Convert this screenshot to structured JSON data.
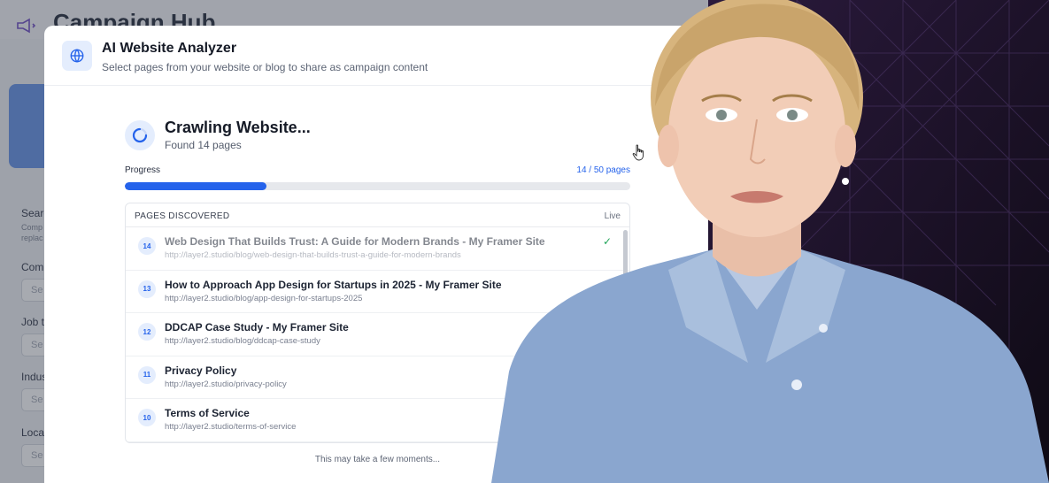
{
  "background_app": {
    "title": "Campaign Hub",
    "sidebar": {
      "search_label": "Searc",
      "search_desc_1": "Comp",
      "search_desc_2": "replac",
      "company_label": "Comp",
      "company_placeholder": "Se",
      "job_title_label": "Job t",
      "job_title_placeholder": "Se",
      "industry_label": "Indus",
      "industry_placeholder": "Se",
      "location_label": "Locat",
      "location_placeholder": "Se"
    }
  },
  "modal": {
    "title": "AI Website Analyzer",
    "subtitle": "Select pages from your website or blog to share as campaign content",
    "icon": "globe-icon",
    "crawl": {
      "title": "Crawling Website...",
      "subtitle": "Found 14 pages"
    },
    "progress": {
      "label": "Progress",
      "count_text": "14 / 50 pages",
      "fraction": 0.28
    },
    "pages_panel": {
      "header": "PAGES DISCOVERED",
      "status": "Live",
      "pages": [
        {
          "num": "14",
          "title": "Web Design That Builds Trust: A Guide for Modern Brands - My Framer Site",
          "url": "http://layer2.studio/blog/web-design-that-builds-trust-a-guide-for-modern-brands",
          "checked": true
        },
        {
          "num": "13",
          "title": "How to Approach App Design for Startups in 2025 - My Framer Site",
          "url": "http://layer2.studio/blog/app-design-for-startups-2025",
          "checked": true
        },
        {
          "num": "12",
          "title": "DDCAP Case Study - My Framer Site",
          "url": "http://layer2.studio/blog/ddcap-case-study",
          "checked": true
        },
        {
          "num": "11",
          "title": "Privacy Policy",
          "url": "http://layer2.studio/privacy-policy",
          "checked": false
        },
        {
          "num": "10",
          "title": "Terms of Service",
          "url": "http://layer2.studio/terms-of-service",
          "checked": false
        }
      ]
    },
    "footer_note": "This may take a few moments..."
  },
  "colors": {
    "accent": "#2563eb",
    "check": "#22a55a"
  }
}
